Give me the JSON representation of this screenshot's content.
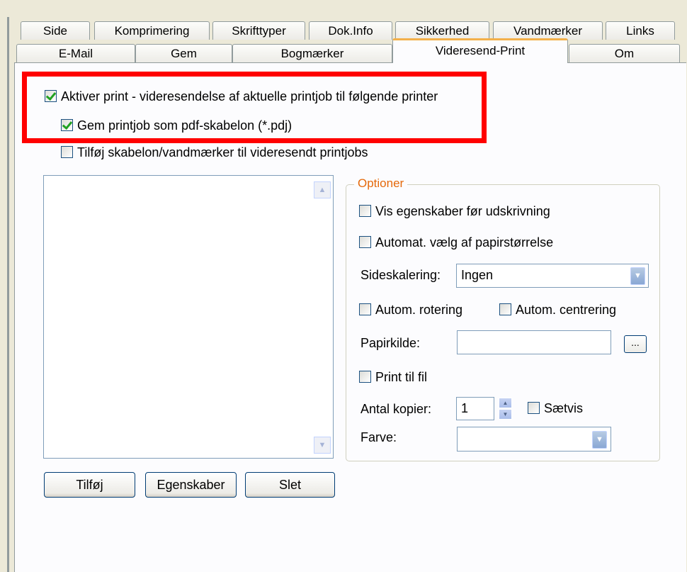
{
  "tabs": {
    "row1": [
      "Side",
      "Komprimering",
      "Skrifttyper",
      "Dok.Info",
      "Sikkerhed",
      "Vandmærker",
      "Links"
    ],
    "row2": [
      "E-Mail",
      "Gem",
      "Bogmærker",
      "Videresend-Print",
      "Om"
    ],
    "active": "Videresend-Print"
  },
  "options": {
    "activate_forwarding": {
      "label": "Aktiver print - videresendelse af aktuelle printjob til følgende printer",
      "checked": true
    },
    "save_template": {
      "label": "Gem printjob som pdf-skabelon (*.pdj)",
      "checked": true
    },
    "add_template": {
      "label": "Tilføj skabelon/vandmærker til videresendt printjobs",
      "checked": false
    }
  },
  "printer_list": {
    "items": [],
    "scroll_up_icon": "scroll-up-arrow",
    "scroll_down_icon": "scroll-down-arrow"
  },
  "buttons": {
    "add": "Tilføj",
    "properties": "Egenskaber",
    "delete": "Slet"
  },
  "group": {
    "title": "Optioner",
    "show_properties": {
      "label": "Vis egenskaber før udskrivning",
      "checked": false
    },
    "auto_paper": {
      "label": "Automat. vælg af papirstørrelse",
      "checked": false
    },
    "page_scaling_label": "Sideskalering:",
    "page_scaling_value": "Ingen",
    "auto_rotate": {
      "label": "Autom. rotering",
      "checked": false
    },
    "auto_center": {
      "label": "Autom. centrering",
      "checked": false
    },
    "paper_source_label": "Papirkilde:",
    "paper_source_value": "",
    "browse_label": "...",
    "print_to_file": {
      "label": "Print til fil",
      "checked": false
    },
    "copies_label": "Antal kopier:",
    "copies_value": "1",
    "collate": {
      "label": "Sætvis",
      "checked": false
    },
    "color_label": "Farve:",
    "color_value": ""
  },
  "colors": {
    "highlight": "#ff0000",
    "group_title": "#e5690b",
    "active_tab_accent": "#f3b04a"
  }
}
